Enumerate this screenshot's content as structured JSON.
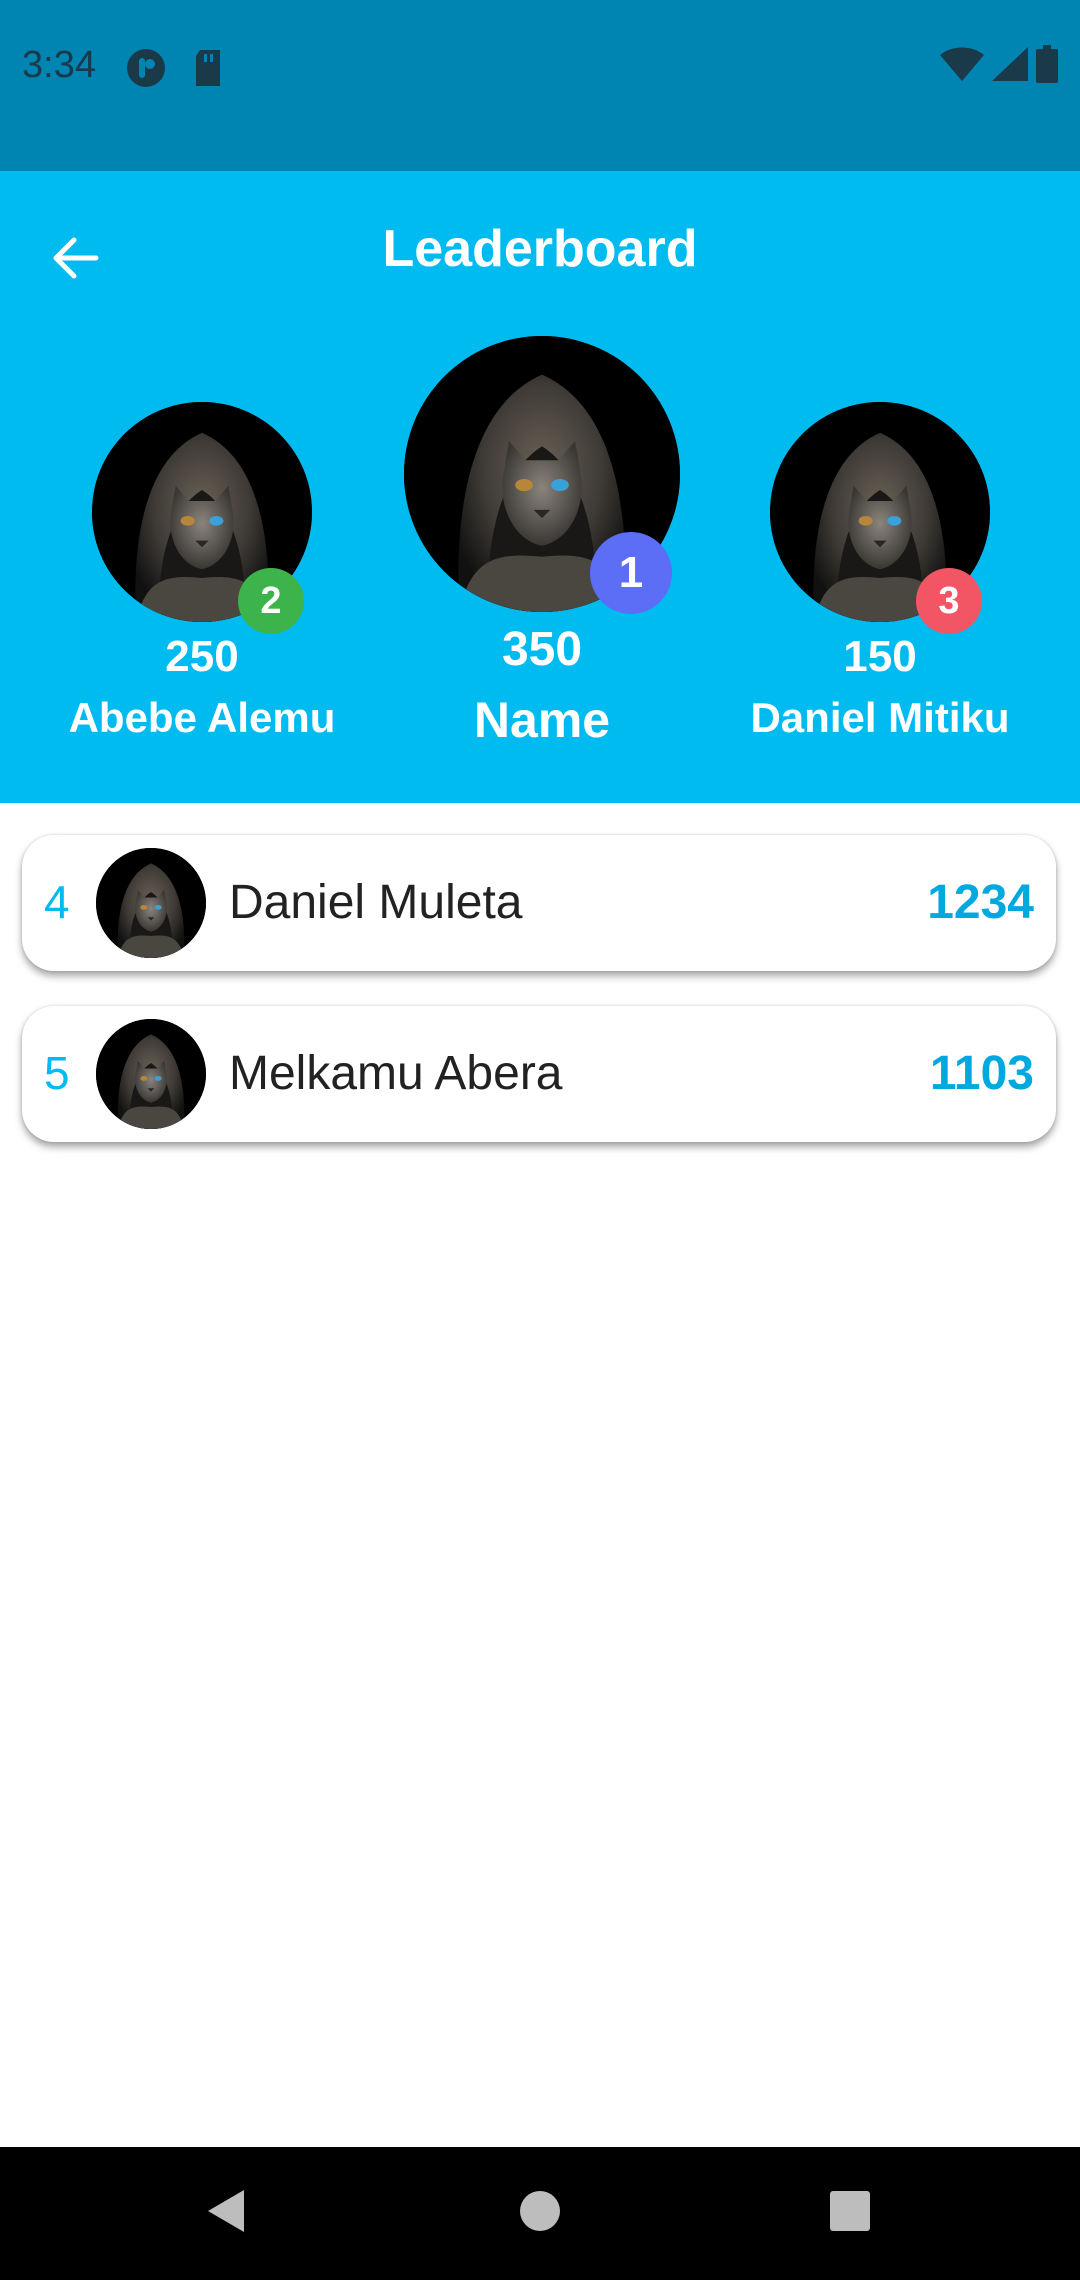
{
  "status_bar": {
    "time": "3:34",
    "icons_left": [
      "app-notification-icon",
      "sd-card-icon"
    ],
    "icons_right": [
      "wifi-icon",
      "cellular-signal-icon",
      "battery-icon"
    ]
  },
  "header": {
    "title": "Leaderboard",
    "back_icon": "arrow-left-icon",
    "background": "#00bbef"
  },
  "podium": {
    "first": {
      "rank": "1",
      "score": "350",
      "name": "Name",
      "badge_color": "#5b6ef5"
    },
    "second": {
      "rank": "2",
      "score": "250",
      "name": "Abebe Alemu",
      "badge_color": "#3cb44b"
    },
    "third": {
      "rank": "3",
      "score": "150",
      "name": "Daniel Mitiku",
      "badge_color": "#f25563"
    }
  },
  "list": [
    {
      "rank": "4",
      "name": "Daniel Muleta",
      "score": "1234"
    },
    {
      "rank": "5",
      "name": "Melkamu Abera",
      "score": "1103"
    }
  ],
  "nav": {
    "back_icon": "triangle-back-icon",
    "home_icon": "circle-home-icon",
    "recents_icon": "square-recents-icon"
  },
  "colors": {
    "status_bar": "#0085b3",
    "accent": "#00bbef"
  }
}
